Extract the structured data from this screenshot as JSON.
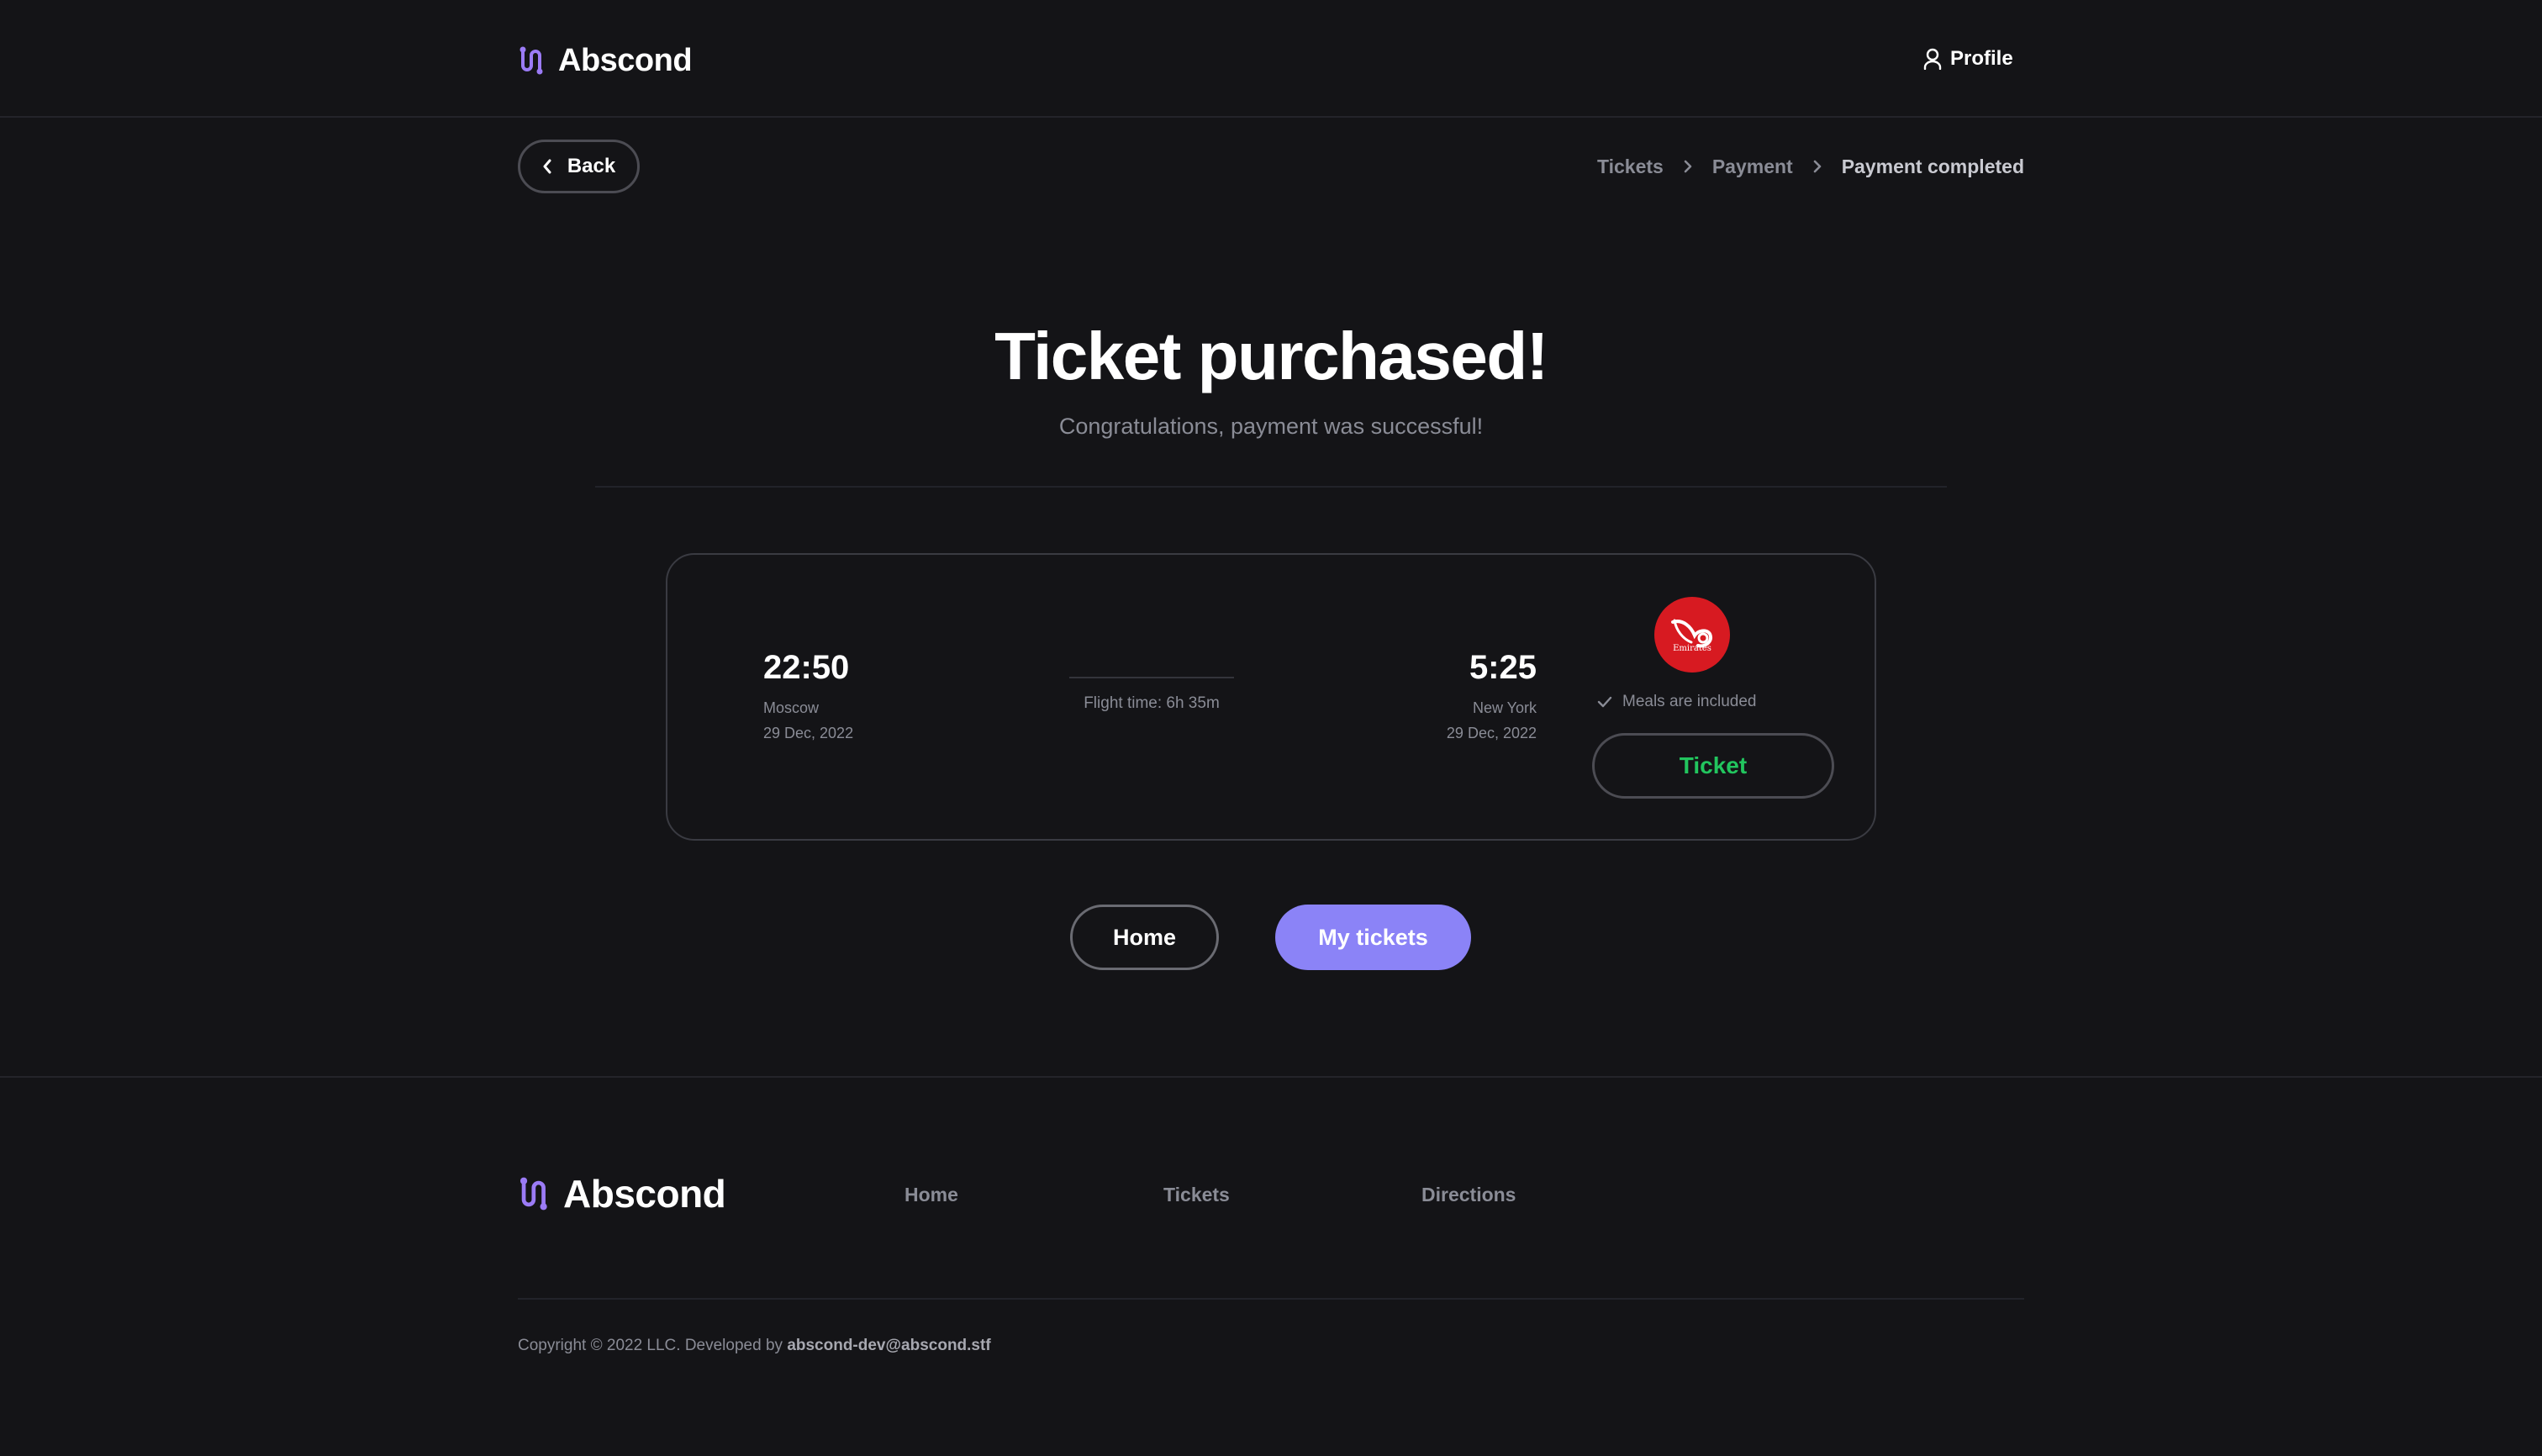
{
  "header": {
    "brand": "Abscond",
    "profile_label": "Profile"
  },
  "nav": {
    "back_label": "Back",
    "breadcrumb": [
      "Tickets",
      "Payment",
      "Payment completed"
    ]
  },
  "hero": {
    "title": "Ticket purchased!",
    "subtitle": "Congratulations, payment was successful!"
  },
  "ticket": {
    "departure": {
      "time": "22:50",
      "city": "Moscow",
      "date": "29 Dec, 2022"
    },
    "arrival": {
      "time": "5:25",
      "city": "New York",
      "date": "29 Dec, 2022"
    },
    "flight_time": "Flight time: 6h 35m",
    "airline_logo_text": "Emirates",
    "meals": "Meals are included",
    "ticket_button": "Ticket"
  },
  "actions": {
    "home": "Home",
    "my_tickets": "My tickets"
  },
  "footer": {
    "brand": "Abscond",
    "links": [
      "Home",
      "Tickets",
      "Directions"
    ],
    "copyright_prefix": "Copyright © 2022 LLC. Developed by ",
    "developer_email": "abscond-dev@abscond.stf"
  },
  "colors": {
    "background": "#141417",
    "accent": "#8b83f7",
    "success": "#22c55e",
    "airline_red": "#d71a21"
  }
}
